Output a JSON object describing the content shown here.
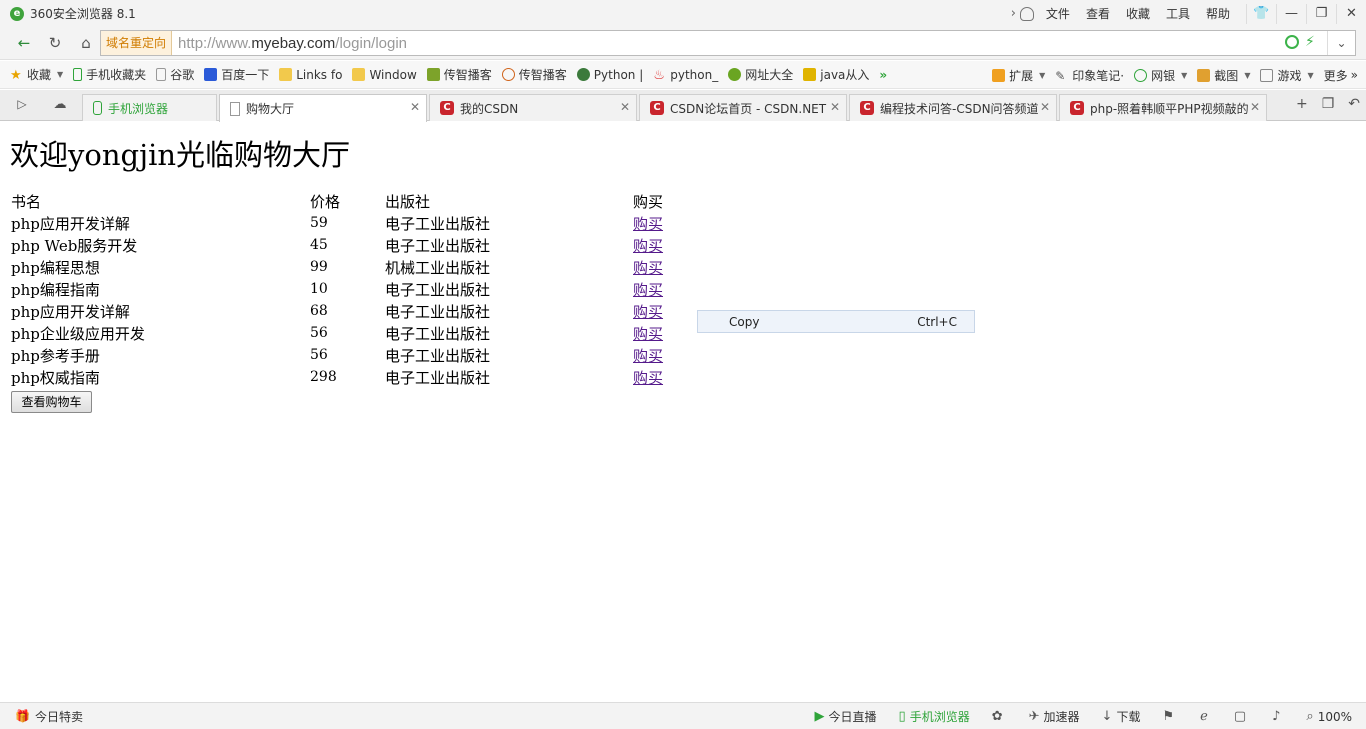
{
  "window": {
    "title": "360安全浏览器 8.1",
    "menu": [
      "文件",
      "查看",
      "收藏",
      "工具",
      "帮助"
    ]
  },
  "address": {
    "redirect_label": "域名重定向",
    "url_prefix": "http://www.",
    "url_domain": "myebay.com",
    "url_path": "/login/login"
  },
  "bookmarks": {
    "items": [
      "收藏",
      "手机收藏夹",
      "谷歌",
      "百度一下",
      "Links fo",
      "Window",
      "传智播客",
      "传智播客",
      "Python |",
      "python_",
      "网址大全",
      "java从入"
    ],
    "right": [
      "扩展",
      "印象笔记·",
      "网银",
      "截图",
      "游戏",
      "更多"
    ]
  },
  "tabs": {
    "items": [
      "手机浏览器",
      "购物大厅",
      "我的CSDN",
      "CSDN论坛首页 - CSDN.NET",
      "编程技术问答-CSDN问答频道",
      "php-照着韩顺平PHP视频敲的"
    ]
  },
  "page": {
    "welcome": "欢迎yongjin光临购物大厅",
    "headers": [
      "书名",
      "价格",
      "出版社",
      "购买"
    ],
    "rows": [
      {
        "name": "php应用开发详解",
        "price": "59",
        "publisher": "电子工业出版社",
        "buy": "购买"
      },
      {
        "name": "php Web服务开发",
        "price": "45",
        "publisher": "电子工业出版社",
        "buy": "购买"
      },
      {
        "name": "php编程思想",
        "price": "99",
        "publisher": "机械工业出版社",
        "buy": "购买"
      },
      {
        "name": "php编程指南",
        "price": "10",
        "publisher": "电子工业出版社",
        "buy": "购买"
      },
      {
        "name": "php应用开发详解",
        "price": "68",
        "publisher": "电子工业出版社",
        "buy": "购买"
      },
      {
        "name": "php企业级应用开发",
        "price": "56",
        "publisher": "电子工业出版社",
        "buy": "购买"
      },
      {
        "name": "php参考手册",
        "price": "56",
        "publisher": "电子工业出版社",
        "buy": "购买"
      },
      {
        "name": "php权威指南",
        "price": "298",
        "publisher": "电子工业出版社",
        "buy": "购买"
      }
    ],
    "cart_button": "查看购物车"
  },
  "context_menu": {
    "label": "Copy",
    "shortcut": "Ctrl+C"
  },
  "status": {
    "left": "今日特卖",
    "items": [
      "今日直播",
      "手机浏览器",
      "加速器",
      "下载"
    ],
    "zoom": "100%"
  }
}
